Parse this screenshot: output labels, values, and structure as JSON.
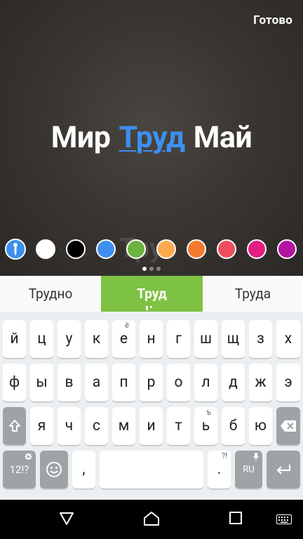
{
  "editor": {
    "done_label": "Готово",
    "caption_before": "Мир",
    "caption_highlight": "Труд",
    "caption_after": "Май",
    "ghost_text": "Тру",
    "palette_colors": [
      "#ffffff",
      "#000000",
      "#3d8ff0",
      "#6db33f",
      "#ffa94d",
      "#f47a2e",
      "#ee4f5c",
      "#e31d84",
      "#b4129f"
    ],
    "page_dots": 3,
    "active_page": 0
  },
  "suggestions": [
    "Трудно",
    "Труд",
    "Труда"
  ],
  "keyboard": {
    "row1": [
      "й",
      "ц",
      "у",
      "к",
      "е",
      "н",
      "г",
      "ш",
      "щ",
      "з",
      "х"
    ],
    "row1_hint": "ё",
    "row2": [
      "ф",
      "ы",
      "в",
      "а",
      "п",
      "р",
      "о",
      "л",
      "д",
      "ж",
      "э"
    ],
    "row3": [
      "я",
      "ч",
      "с",
      "м",
      "и",
      "т",
      "ь",
      "б",
      "ю"
    ],
    "row3_hint": "ъ",
    "symbols_label": "12!?",
    "comma_label": ",",
    "period_label": ".",
    "period_hint": "?!",
    "language_label": "RU"
  },
  "colors": {
    "accent_blue": "#3d8ff0",
    "suggestion_green": "#7dc242"
  }
}
